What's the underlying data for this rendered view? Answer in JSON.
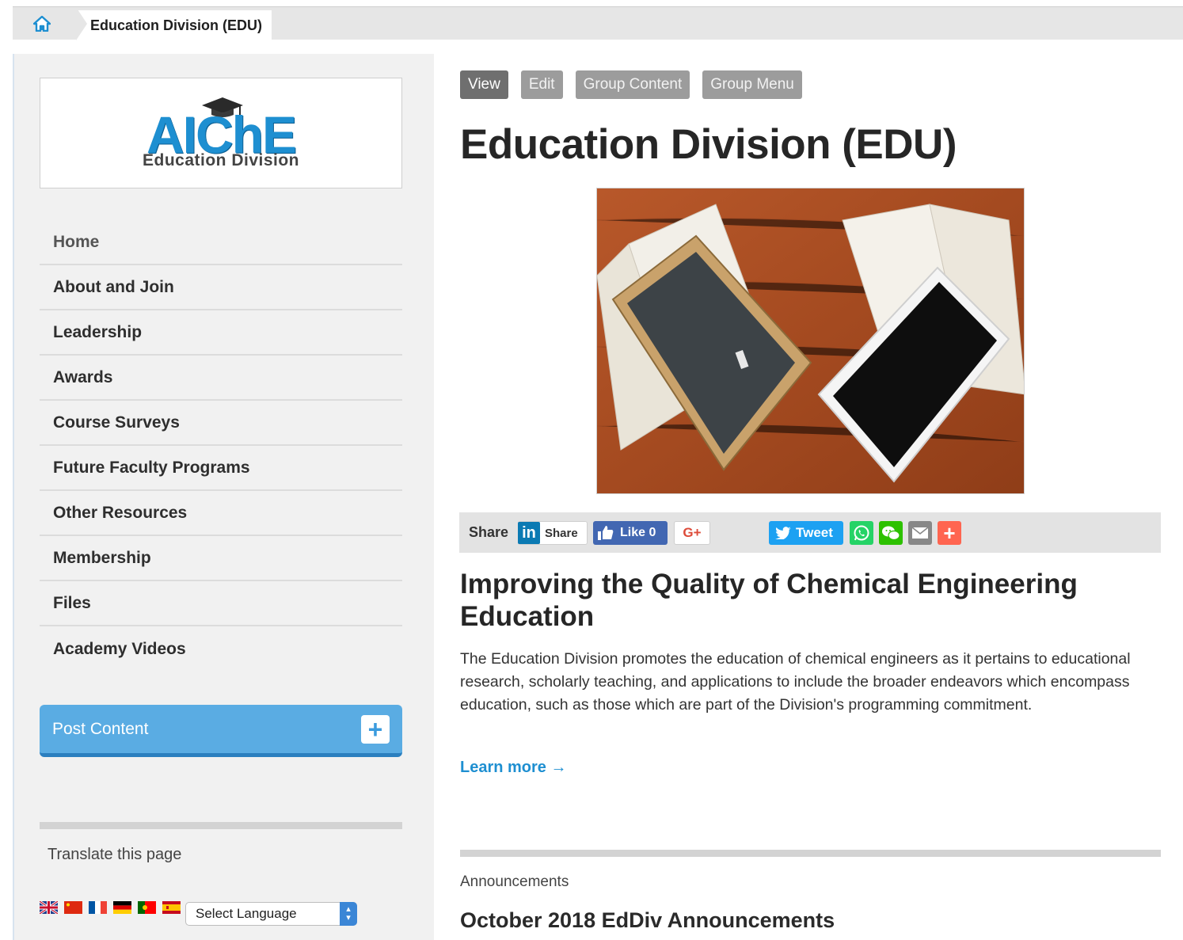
{
  "breadcrumb": {
    "current": "Education Division (EDU)"
  },
  "logo": {
    "main": "AIChE",
    "sub": "Education Division"
  },
  "sidebar": {
    "nav": [
      {
        "label": "Home"
      },
      {
        "label": "About and Join"
      },
      {
        "label": "Leadership"
      },
      {
        "label": "Awards"
      },
      {
        "label": "Course Surveys"
      },
      {
        "label": "Future Faculty Programs"
      },
      {
        "label": "Other Resources"
      },
      {
        "label": "Membership"
      },
      {
        "label": "Files"
      },
      {
        "label": "Academy Videos"
      }
    ],
    "post_content_label": "Post Content",
    "translate_label": "Translate this page",
    "language_select": "Select Language"
  },
  "tabs": [
    {
      "label": "View"
    },
    {
      "label": "Edit"
    },
    {
      "label": "Group Content"
    },
    {
      "label": "Group Menu"
    }
  ],
  "main": {
    "title": "Education Division (EDU)",
    "share": {
      "label": "Share",
      "linkedin_label": "Share",
      "like_label": "Like 0",
      "gplus_label": "G+",
      "tweet_label": "Tweet"
    },
    "subheading": "Improving the Quality of Chemical Engineering Education",
    "body": "The Education Division promotes the education of chemical engineers as it pertains to educational research, scholarly teaching, and applications to include the broader endeavors which encompass education, such as those which are part of the Division's programming commitment.",
    "learn_more": "Learn more →",
    "announcements_label": "Announcements",
    "announcement_title": "October 2018 EdDiv Announcements"
  },
  "colors": {
    "accent_blue": "#1e8fd1",
    "post_button": "#5aace3",
    "tab_active": "#6f6f6f",
    "tab_inactive": "#9c9c9c"
  }
}
